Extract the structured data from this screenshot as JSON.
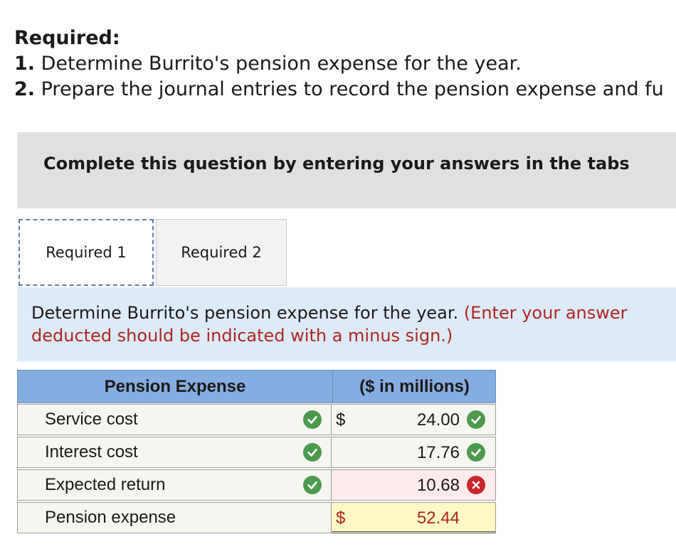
{
  "required": {
    "heading": "Required:",
    "items": [
      {
        "num": "1.",
        "text": " Determine Burrito's pension expense for the year."
      },
      {
        "num": "2.",
        "text": " Prepare the journal entries to record the pension expense and fu"
      }
    ]
  },
  "banner": {
    "text": "Complete this question by entering your answers in the tabs"
  },
  "tabs": [
    {
      "label": "Required 1"
    },
    {
      "label": "Required 2"
    }
  ],
  "instructions": {
    "main": "Determine Burrito's pension expense for the year. ",
    "note_line1": "(Enter your answer",
    "note_line2": "deducted should be indicated with a minus sign.)"
  },
  "table": {
    "header_left": "Pension Expense",
    "header_right": "($ in millions)",
    "rows": [
      {
        "label": "Service cost",
        "dollar": "$",
        "value": "24.00",
        "status": "correct"
      },
      {
        "label": "Interest cost",
        "dollar": "",
        "value": "17.76",
        "status": "correct"
      },
      {
        "label": "Expected return",
        "dollar": "",
        "value": "10.68",
        "status": "incorrect"
      },
      {
        "label": "Pension expense",
        "dollar": "$",
        "value": "52.44",
        "status": "total"
      }
    ]
  },
  "icons": {
    "correct": "check-circle-icon",
    "incorrect": "x-circle-icon"
  },
  "colors": {
    "correct": "#4c9a4c",
    "incorrect": "#c8282b",
    "header": "#86ade0",
    "panel": "#ddeaf7"
  }
}
